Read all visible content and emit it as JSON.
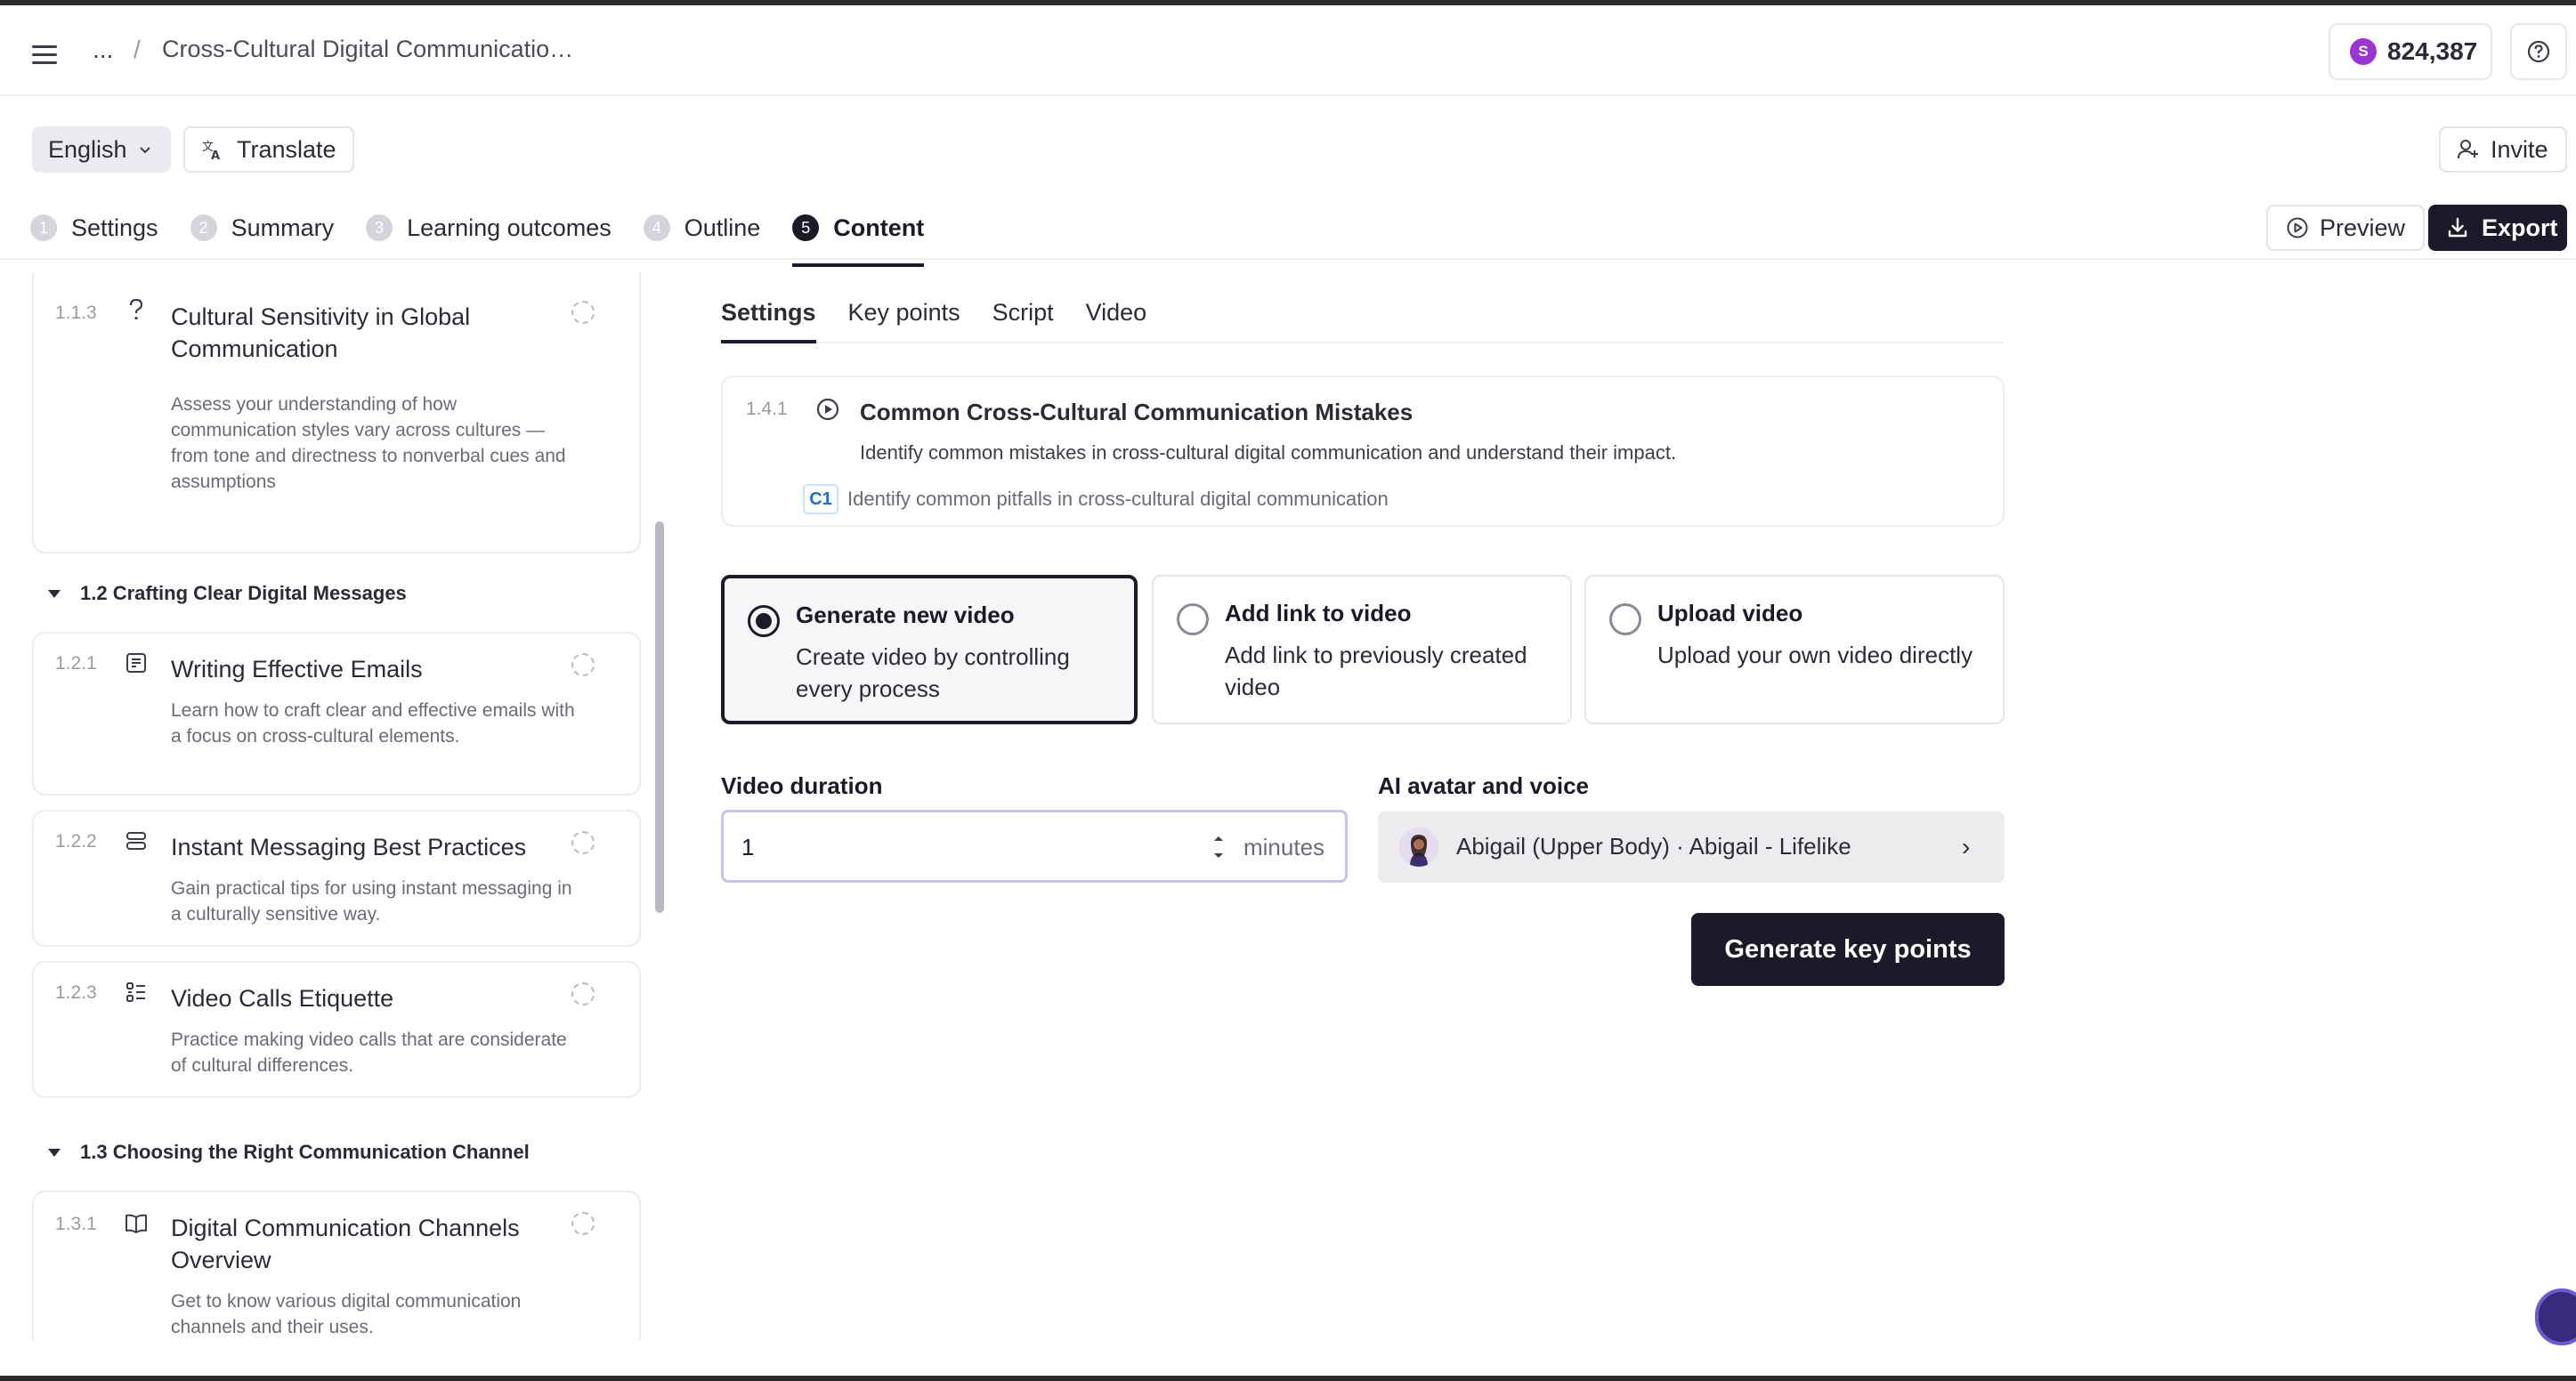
{
  "header": {
    "breadcrumb_ellipsis": "...",
    "breadcrumb_sep": "/",
    "title": "Cross-Cultural Digital Communicatio…",
    "credits_badge": "S",
    "credits": "824,387"
  },
  "toolbar": {
    "language": "English",
    "translate": "Translate",
    "invite": "Invite",
    "preview": "Preview",
    "export": "Export"
  },
  "steps": [
    {
      "num": "1",
      "label": "Settings"
    },
    {
      "num": "2",
      "label": "Summary"
    },
    {
      "num": "3",
      "label": "Learning outcomes"
    },
    {
      "num": "4",
      "label": "Outline"
    },
    {
      "num": "5",
      "label": "Content"
    }
  ],
  "sidebar": {
    "cards": [
      {
        "num": "1.1.3",
        "icon": "question-icon",
        "title": "Cultural Sensitivity in Global Communication",
        "desc": "Assess your understanding of how communication styles vary across cultures — from tone and directness to nonverbal cues and assumptions"
      },
      {
        "num": "1.2.1",
        "icon": "document-icon",
        "title": "Writing Effective Emails",
        "desc": "Learn how to craft clear and effective emails with a focus on cross-cultural elements."
      },
      {
        "num": "1.2.2",
        "icon": "stack-icon",
        "title": "Instant Messaging Best Practices",
        "desc": "Gain practical tips for using instant messaging in a culturally sensitive way."
      },
      {
        "num": "1.2.3",
        "icon": "checklist-icon",
        "title": "Video Calls Etiquette",
        "desc": "Practice making video calls that are considerate of cultural differences."
      },
      {
        "num": "1.3.1",
        "icon": "book-icon",
        "title": "Digital Communication Channels Overview",
        "desc": "Get to know various digital communication channels and their uses."
      }
    ],
    "sections": [
      {
        "title": "1.2 Crafting Clear Digital Messages"
      },
      {
        "title": "1.3 Choosing the Right Communication Channel"
      }
    ]
  },
  "main": {
    "tabs": [
      "Settings",
      "Key points",
      "Script",
      "Video"
    ],
    "lesson": {
      "num": "1.4.1",
      "title": "Common Cross-Cultural Communication Mistakes",
      "desc": "Identify common mistakes in cross-cultural digital communication and understand their impact.",
      "tag": "C1",
      "tag_text": "Identify common pitfalls in cross-cultural digital communication"
    },
    "options": [
      {
        "title": "Generate new video",
        "desc": "Create video by controlling every process",
        "selected": true
      },
      {
        "title": "Add link to video",
        "desc": "Add link to previously created video",
        "selected": false
      },
      {
        "title": "Upload video",
        "desc": "Upload your own video directly",
        "selected": false
      }
    ],
    "duration_label": "Video duration",
    "duration_value": "1",
    "duration_unit": "minutes",
    "avatar_label": "AI avatar and voice",
    "avatar_value": "Abigail (Upper Body) · Abigail - Lifelike",
    "generate_button": "Generate key points"
  }
}
